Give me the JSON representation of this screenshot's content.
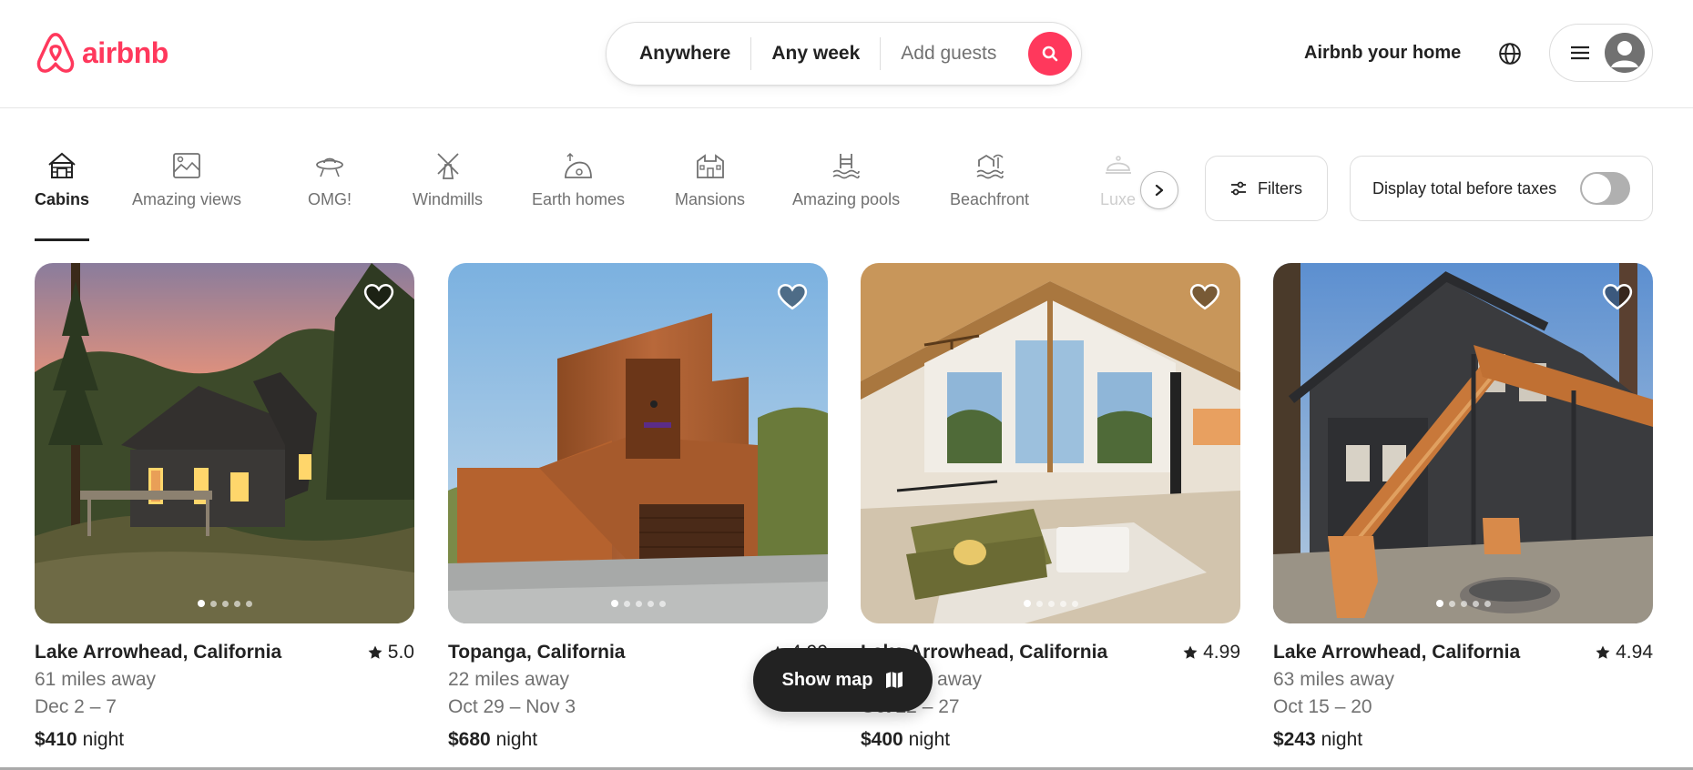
{
  "brand": {
    "name": "airbnb",
    "color": "#ff385c",
    "icon": "airbnb-logo-icon"
  },
  "search": {
    "where": "Anywhere",
    "when": "Any week",
    "who": "Add guests",
    "button_icon": "search-icon"
  },
  "nav": {
    "host_label": "Airbnb your home",
    "globe_icon": "globe-icon",
    "menu_icon": "hamburger-icon",
    "avatar_icon": "avatar-icon"
  },
  "categories": [
    {
      "label": "Cabins",
      "icon": "cabin-icon",
      "active": true
    },
    {
      "label": "Amazing views",
      "icon": "amazing-views-icon"
    },
    {
      "label": "OMG!",
      "icon": "ufo-icon"
    },
    {
      "label": "Windmills",
      "icon": "windmill-icon"
    },
    {
      "label": "Earth homes",
      "icon": "earth-home-icon"
    },
    {
      "label": "Mansions",
      "icon": "mansion-icon"
    },
    {
      "label": "Amazing pools",
      "icon": "pool-icon"
    },
    {
      "label": "Beachfront",
      "icon": "beachfront-icon"
    },
    {
      "label": "Luxe",
      "icon": "luxe-icon"
    }
  ],
  "filters": {
    "label": "Filters",
    "icon": "sliders-icon"
  },
  "taxes": {
    "label": "Display total before taxes",
    "enabled": false
  },
  "listings": [
    {
      "location": "Lake Arrowhead, California",
      "rating": "5.0",
      "distance": "61 miles away",
      "dates": "Dec 2 – 7",
      "price": "$410",
      "unit": "night"
    },
    {
      "location": "Topanga, California",
      "rating": "4.99",
      "distance": "22 miles away",
      "dates": "Oct 29 – Nov 3",
      "price": "$680",
      "unit": "night"
    },
    {
      "location": "Lake Arrowhead, California",
      "rating": "4.99",
      "distance": "65 miles away",
      "dates": "Oct 22 – 27",
      "price": "$400",
      "unit": "night"
    },
    {
      "location": "Lake Arrowhead, California",
      "rating": "4.94",
      "distance": "63 miles away",
      "dates": "Oct 15 – 20",
      "price": "$243",
      "unit": "night"
    }
  ],
  "show_map": {
    "label": "Show map",
    "icon": "map-icon"
  },
  "colors": {
    "accent": "#ff385c",
    "text": "#222222",
    "muted": "#717171",
    "border": "#dddddd"
  }
}
